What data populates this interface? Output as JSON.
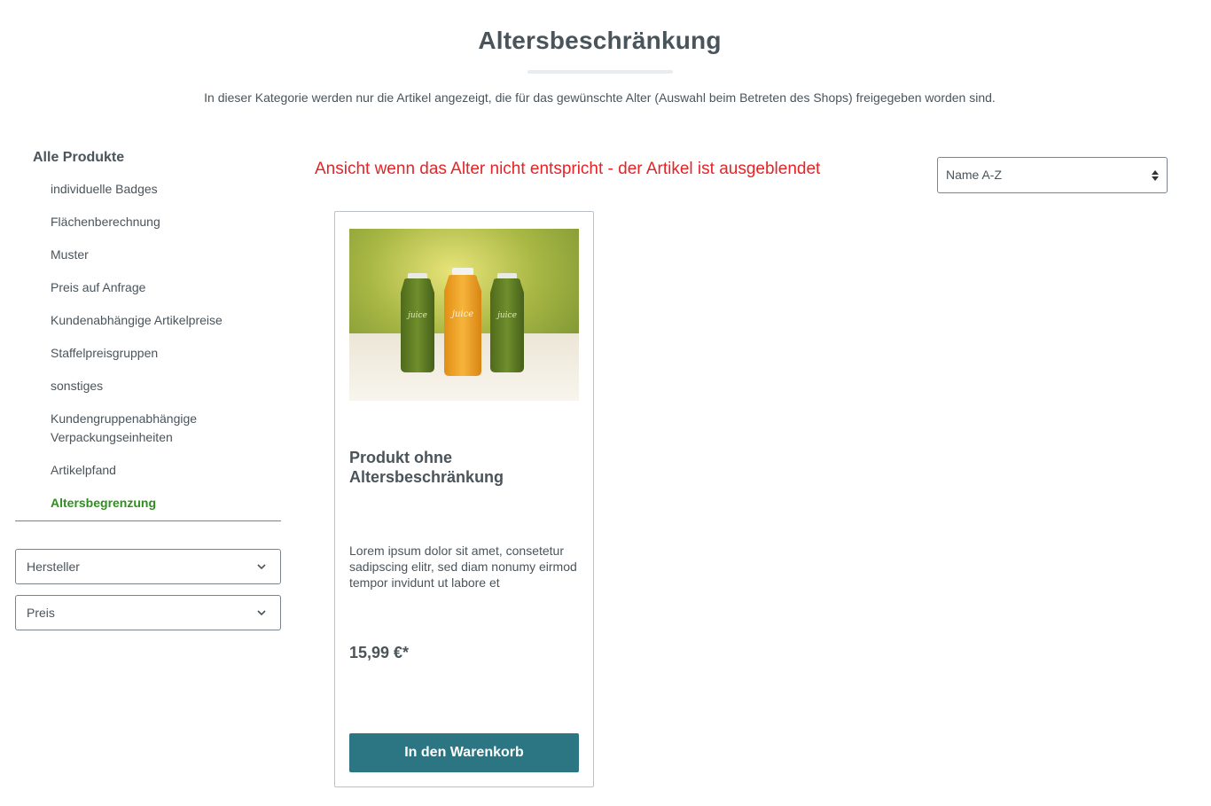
{
  "page": {
    "title": "Altersbeschränkung",
    "description": "In dieser Kategorie werden nur die Artikel angezeigt, die für das gewünschte Alter (Auswahl beim Betreten des Shops) freigegeben worden sind."
  },
  "sidebar": {
    "root_label": "Alle Produkte",
    "items": [
      {
        "label": "individuelle Badges"
      },
      {
        "label": "Flächenberechnung"
      },
      {
        "label": "Muster"
      },
      {
        "label": "Preis auf Anfrage"
      },
      {
        "label": "Kundenabhängige Artikelpreise"
      },
      {
        "label": "Staffelpreisgruppen"
      },
      {
        "label": "sonstiges"
      },
      {
        "label": "Kundengruppenabhängige Verpackungseinheiten"
      },
      {
        "label": "Artikelpfand"
      },
      {
        "label": "Altersbegrenzung",
        "active": true
      }
    ],
    "active_color": "#2e8f1e"
  },
  "filters": {
    "manufacturer_label": "Hersteller",
    "price_label": "Preis"
  },
  "notice": {
    "text": "Ansicht wenn das Alter nicht entspricht - der Artikel ist ausgeblendet",
    "color": "#e52427"
  },
  "sorting": {
    "selected": "Name A-Z"
  },
  "product": {
    "name": "Produkt ohne Altersbeschränkung",
    "description": "Lorem ipsum dolor sit amet, consetetur sadipscing elitr, sed diam nonumy eirmod tempor invidunt ut labore et",
    "price": "15,99 €*",
    "button_label": "In den Warenkorb",
    "button_color": "#2b7682",
    "image": {
      "bottle_label": "juice",
      "bottles": [
        "green",
        "orange",
        "green"
      ]
    }
  }
}
